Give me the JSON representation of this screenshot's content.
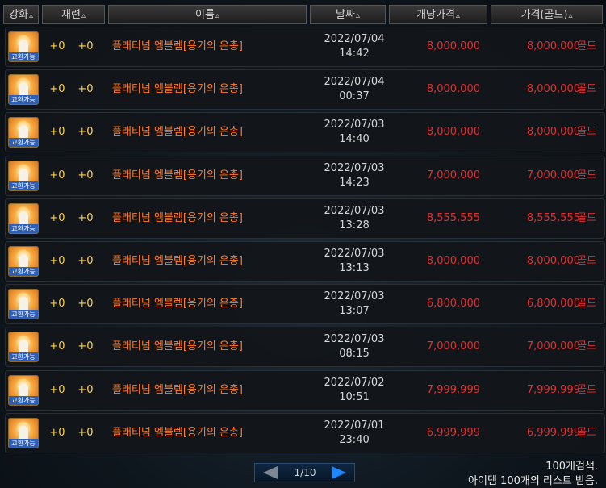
{
  "headers": [
    {
      "key": "enhance",
      "label": "강화"
    },
    {
      "key": "refine",
      "label": "재련"
    },
    {
      "key": "name",
      "label": "이름"
    },
    {
      "key": "date",
      "label": "날짜"
    },
    {
      "key": "unit_price",
      "label": "개당가격"
    },
    {
      "key": "price",
      "label": "가격(골드)"
    }
  ],
  "sort_icon": "▵",
  "icon_stamp": "교환가능",
  "gold_suffix": "골드",
  "rows": [
    {
      "enhance": "+0",
      "refine": "+0",
      "name": "플래티넘 엠블렘[용기의 은총]",
      "date": "2022/07/04",
      "time": "14:42",
      "unit_price": "8,000,000",
      "price": "8,000,000"
    },
    {
      "enhance": "+0",
      "refine": "+0",
      "name": "플래티넘 엠블렘[용기의 은총]",
      "date": "2022/07/04",
      "time": "00:37",
      "unit_price": "8,000,000",
      "price": "8,000,000"
    },
    {
      "enhance": "+0",
      "refine": "+0",
      "name": "플래티넘 엠블렘[용기의 은총]",
      "date": "2022/07/03",
      "time": "14:40",
      "unit_price": "8,000,000",
      "price": "8,000,000"
    },
    {
      "enhance": "+0",
      "refine": "+0",
      "name": "플래티넘 엠블렘[용기의 은총]",
      "date": "2022/07/03",
      "time": "14:23",
      "unit_price": "7,000,000",
      "price": "7,000,000"
    },
    {
      "enhance": "+0",
      "refine": "+0",
      "name": "플래티넘 엠블렘[용기의 은총]",
      "date": "2022/07/03",
      "time": "13:28",
      "unit_price": "8,555,555",
      "price": "8,555,555"
    },
    {
      "enhance": "+0",
      "refine": "+0",
      "name": "플래티넘 엠블렘[용기의 은총]",
      "date": "2022/07/03",
      "time": "13:13",
      "unit_price": "8,000,000",
      "price": "8,000,000"
    },
    {
      "enhance": "+0",
      "refine": "+0",
      "name": "플래티넘 엠블렘[용기의 은총]",
      "date": "2022/07/03",
      "time": "13:07",
      "unit_price": "6,800,000",
      "price": "6,800,000"
    },
    {
      "enhance": "+0",
      "refine": "+0",
      "name": "플래티넘 엠블렘[용기의 은총]",
      "date": "2022/07/03",
      "time": "08:15",
      "unit_price": "7,000,000",
      "price": "7,000,000"
    },
    {
      "enhance": "+0",
      "refine": "+0",
      "name": "플래티넘 엠블렘[용기의 은총]",
      "date": "2022/07/02",
      "time": "10:51",
      "unit_price": "7,999,999",
      "price": "7,999,999"
    },
    {
      "enhance": "+0",
      "refine": "+0",
      "name": "플래티넘 엠블렘[용기의 은총]",
      "date": "2022/07/01",
      "time": "23:40",
      "unit_price": "6,999,999",
      "price": "6,999,999"
    }
  ],
  "pager": {
    "text": "1/10"
  },
  "footer": {
    "line1": "100개검색.",
    "line2": "아이템 100개의 리스트 받음."
  },
  "colors": {
    "name": "#ff7b2e",
    "price": "#e03030",
    "enhance": "#ffd24a",
    "date": "#d6d6d6"
  }
}
